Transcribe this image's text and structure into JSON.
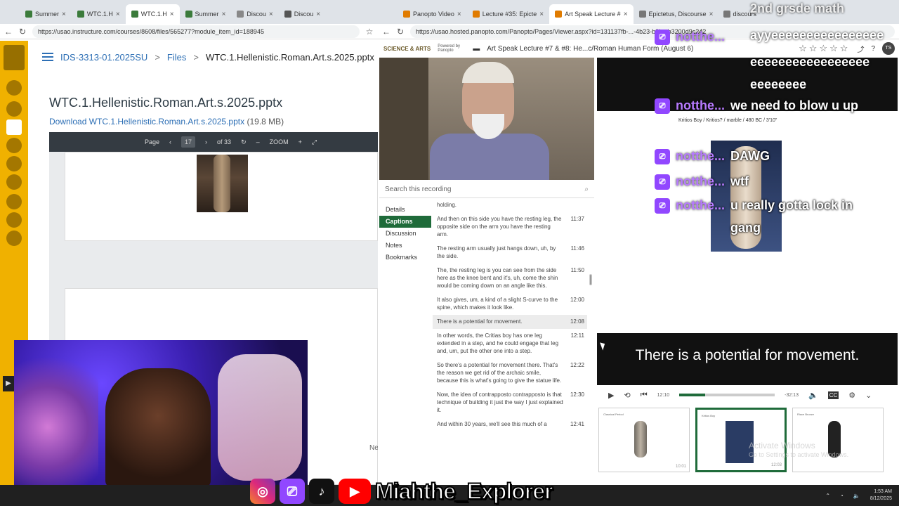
{
  "left_window": {
    "tabs": [
      "Summer",
      "WTC.1.H",
      "WTC.1.H",
      "Summer",
      "Discou",
      "Discou"
    ],
    "url": "https://usao.instructure.com/courses/8608/files/565277?module_item_id=188945",
    "breadcrumb": {
      "course": "IDS-3313-01.2025SU",
      "files": "Files",
      "current": "WTC.1.Hellenistic.Roman.Art.s.2025.pptx",
      "sep": ">"
    },
    "file_title": "WTC.1.Hellenistic.Roman.Art.s.2025.pptx",
    "download_label": "Download WTC.1.Hellenistic.Roman.Art.s.2025.pptx",
    "file_size": "(19.8 MB)",
    "viewer": {
      "page_label": "Page",
      "page_value": "17",
      "page_total": "of 33",
      "zoom_label": "ZOOM"
    },
    "ne_text": "Ne"
  },
  "right_window": {
    "tabs": [
      "Panopto Video",
      "Lecture #35: Epicte",
      "Art Speak Lecture #",
      "Epictetus, Discourse",
      "discours"
    ],
    "url": "https://usao.hosted.panopto.com/Panopto/Pages/Viewer.aspx?id=131137fb-...-4b23-b3bc-b3200d9c242",
    "logo": "SCIENCE & ARTS",
    "powered_by": "Powered by Panopto",
    "title": "Art Speak Lecture #7 & #8: He...c/Roman Human Form (August 6)",
    "user_initials": "TS",
    "search_placeholder": "Search this recording",
    "nav": [
      "Details",
      "Captions",
      "Discussion",
      "Notes",
      "Bookmarks"
    ],
    "captions": [
      {
        "text": "holding.",
        "time": ""
      },
      {
        "text": "And then on this side you have the resting leg, the opposite side on the arm you have the resting arm.",
        "time": "11:37"
      },
      {
        "text": "The resting arm usually just hangs down, uh, by the side.",
        "time": "11:46"
      },
      {
        "text": "The, the resting leg is you can see from the side here as the knee bent and it's, uh, come the shin would be coming down on an angle like this.",
        "time": "11:50"
      },
      {
        "text": "It also gives, um, a kind of a slight S-curve to the spine, which makes it look like.",
        "time": "12:00"
      },
      {
        "text": "There is a potential for movement.",
        "time": "12:08"
      },
      {
        "text": "In other words, the Critias boy has one leg extended in a step, and he could engage that leg and, um, put the other one into a step.",
        "time": "12:11"
      },
      {
        "text": "So there's a potential for movement there. That's the reason we get rid of the archaic smile, because this is what's going to give the statue life.",
        "time": "12:22"
      },
      {
        "text": "Now, the idea of contrapposto contrapposto is that technique of building it just the way I just explained it.",
        "time": "12:30"
      },
      {
        "text": "And within 30 years, we'll see this much of a",
        "time": "12:41"
      }
    ],
    "slide_caption": "Kritios Boy / Kritios? / marble / 480 BC / 3'10\"",
    "caption_overlay": "There is a potential for movement.",
    "player": {
      "current_time": "12:10",
      "remaining": "-32:13",
      "progress": 0.27
    },
    "thumbs": [
      {
        "title": "Classical Period",
        "duration": "10:01"
      },
      {
        "title": "Kritios Boy",
        "duration": "12:03"
      },
      {
        "title": "Riace Bronze",
        "duration": ""
      }
    ],
    "activate_title": "Activate Windows",
    "activate_sub": "Go to Settings to activate Windows."
  },
  "stream_overlay": {
    "top_text": "2nd grsde math",
    "spam_text": "ayyeeeeeeeeeeeeeeee",
    "chat": [
      {
        "user": "notthe...",
        "msg": "eeeeeeeeeeeeeeeee eeeeeeee"
      },
      {
        "user": "notthe...",
        "msg": "we need to blow u up"
      },
      {
        "user": "notthe...",
        "msg": "DAWG"
      },
      {
        "user": "notthe...",
        "msg": "wtf"
      },
      {
        "user": "notthe...",
        "msg": "u really gotta lock in gang"
      }
    ],
    "handle": "Miahthe_Explorer"
  },
  "taskbar": {
    "time": "1:53 AM",
    "date": "8/12/2025"
  }
}
